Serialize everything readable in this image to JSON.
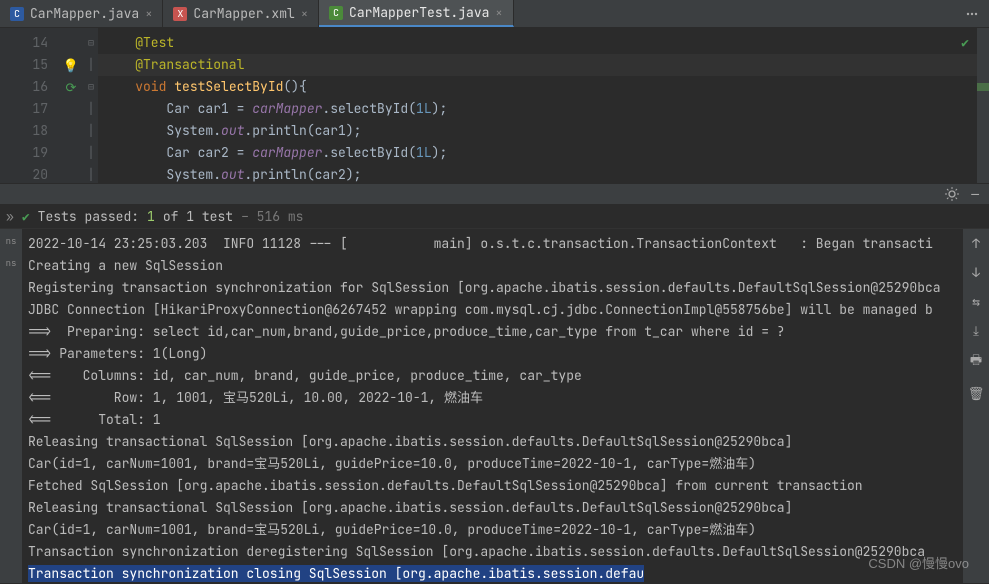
{
  "tabs": [
    {
      "label": "CarMapper.java",
      "icon": "C",
      "active": false
    },
    {
      "label": "CarMapper.xml",
      "icon": "X",
      "active": false
    },
    {
      "label": "CarMapperTest.java",
      "icon": "C",
      "active": true
    }
  ],
  "gutter": [
    "14",
    "15",
    "16",
    "17",
    "18",
    "19",
    "20"
  ],
  "code": {
    "l14": {
      "ann": "@Test"
    },
    "l15": {
      "ann": "@Transactional"
    },
    "l16": {
      "kw": "void ",
      "fn": "testSelectById",
      "rest": "(){"
    },
    "l17": {
      "a": "Car car1 = ",
      "b": "carMapper",
      "c": ".selectById(",
      "n": "1L",
      "d": ");"
    },
    "l18": {
      "a": "System.",
      "b": "out",
      "c": ".println(car1);"
    },
    "l19": {
      "a": "Car car2 = ",
      "b": "carMapper",
      "c": ".selectById(",
      "n": "1L",
      "d": ");"
    },
    "l20": {
      "a": "System.",
      "b": "out",
      "c": ".println(car2);"
    }
  },
  "test_status": {
    "prefix": "Tests passed:",
    "count": "1",
    "suffix": "of 1 test",
    "time": "– 516 ms"
  },
  "console": [
    "2022-10-14 23:25:03.203  INFO 11128 --- [           main] o.s.t.c.transaction.TransactionContext   : Began transacti",
    "Creating a new SqlSession",
    "Registering transaction synchronization for SqlSession [org.apache.ibatis.session.defaults.DefaultSqlSession@25290bca",
    "JDBC Connection [HikariProxyConnection@6267452 wrapping com.mysql.cj.jdbc.ConnectionImpl@558756be] will be managed b",
    "==>  Preparing: select id,car_num,brand,guide_price,produce_time,car_type from t_car where id = ?",
    "==> Parameters: 1(Long)",
    "<==    Columns: id, car_num, brand, guide_price, produce_time, car_type",
    "<==        Row: 1, 1001, 宝马520Li, 10.00, 2022-10-1, 燃油车",
    "<==      Total: 1",
    "Releasing transactional SqlSession [org.apache.ibatis.session.defaults.DefaultSqlSession@25290bca]",
    "Car(id=1, carNum=1001, brand=宝马520Li, guidePrice=10.0, produceTime=2022-10-1, carType=燃油车)",
    "Fetched SqlSession [org.apache.ibatis.session.defaults.DefaultSqlSession@25290bca] from current transaction",
    "Releasing transactional SqlSession [org.apache.ibatis.session.defaults.DefaultSqlSession@25290bca]",
    "Car(id=1, carNum=1001, brand=宝马520Li, guidePrice=10.0, produceTime=2022-10-1, carType=燃油车)",
    "Transaction synchronization deregistering SqlSession [org.apache.ibatis.session.defaults.DefaultSqlSession@25290bca"
  ],
  "console_last": "Transaction synchronization closing SqlSession [org.apache.ibatis.session.defau",
  "watermark": "CSDN @慢慢ovo"
}
